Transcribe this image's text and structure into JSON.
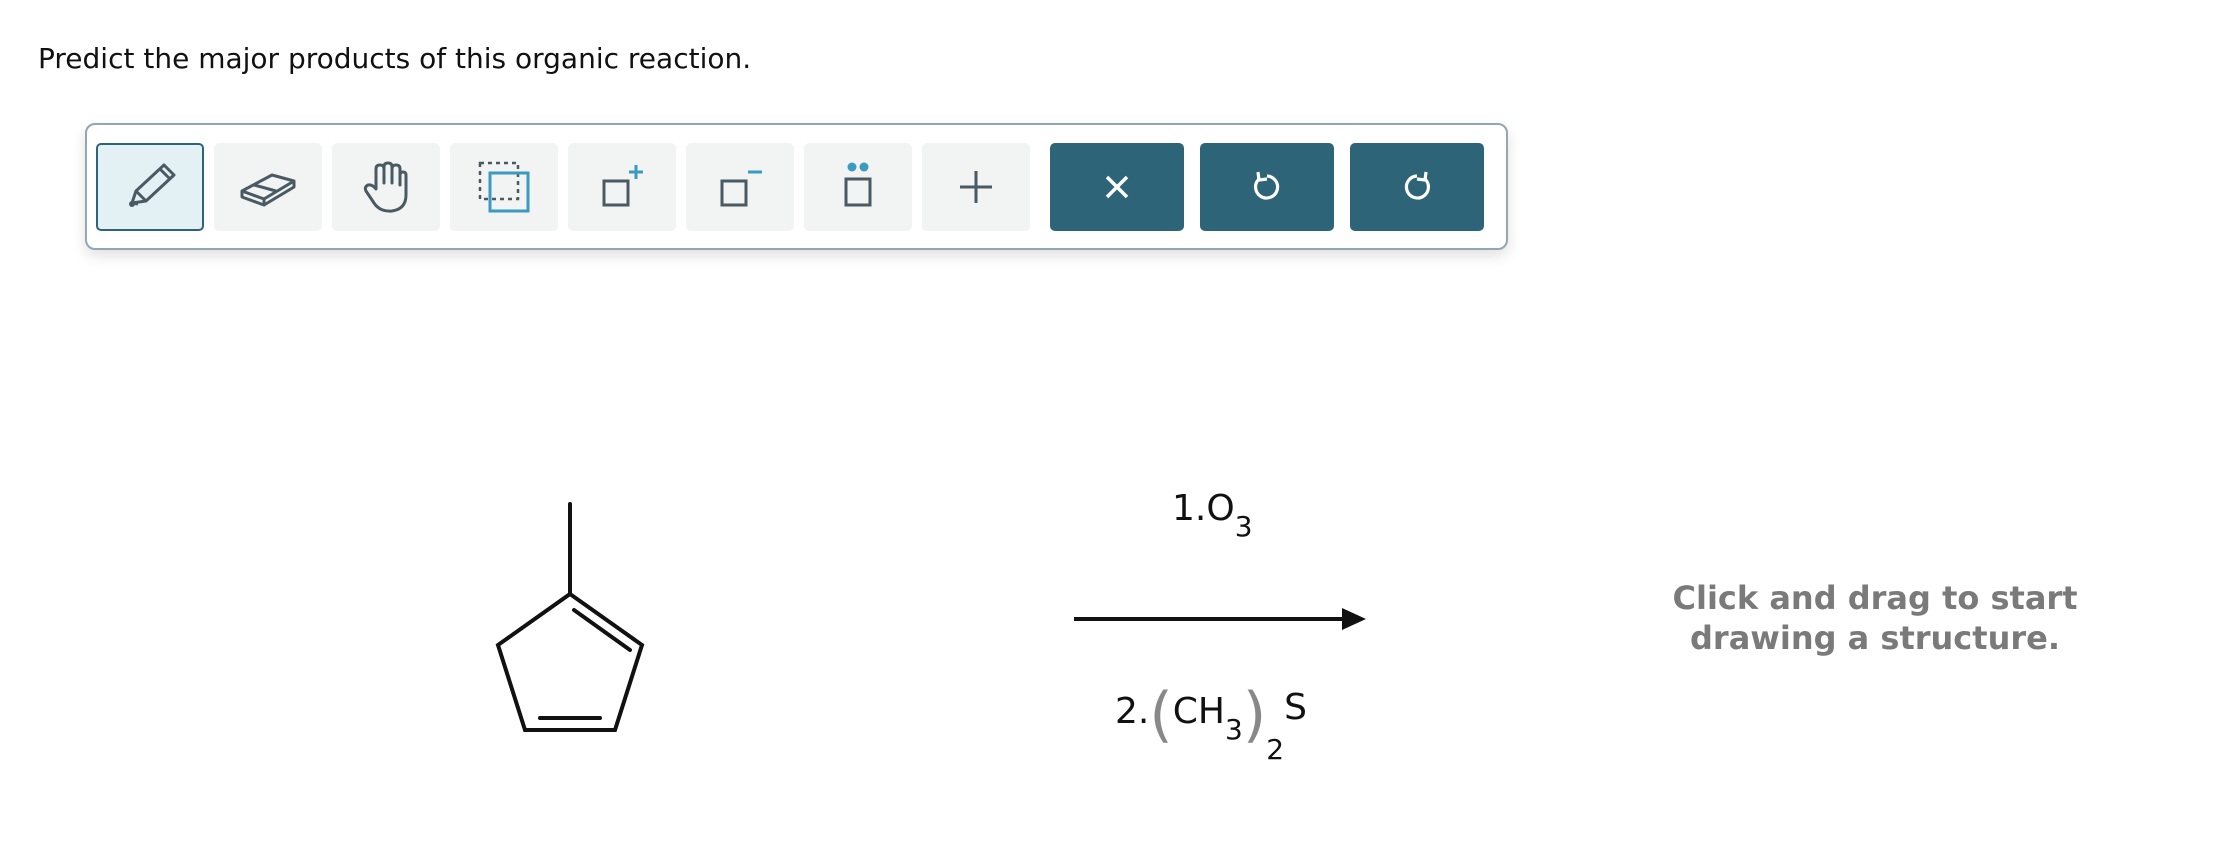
{
  "question": {
    "prompt": "Predict the major products of this organic reaction."
  },
  "toolbar": {
    "tools": [
      {
        "name": "draw",
        "icon": "pencil-icon",
        "selected": true
      },
      {
        "name": "erase",
        "icon": "eraser-icon"
      },
      {
        "name": "move",
        "icon": "hand-icon"
      },
      {
        "name": "select",
        "icon": "lasso-select-icon"
      },
      {
        "name": "increase-charge",
        "icon": "square-plus-icon"
      },
      {
        "name": "decrease-charge",
        "icon": "square-minus-icon"
      },
      {
        "name": "lone-pair",
        "icon": "square-dots-icon"
      },
      {
        "name": "add-arrow",
        "icon": "plus-icon"
      }
    ],
    "actions": [
      {
        "name": "clear",
        "icon": "close-icon"
      },
      {
        "name": "undo",
        "icon": "undo-icon"
      },
      {
        "name": "redo",
        "icon": "redo-icon"
      }
    ],
    "colors": {
      "accent": "#2e6477",
      "tool_bg": "#f2f3f3",
      "selected_bg": "#e3f1f5",
      "icon_blue": "#3a9ac0"
    }
  },
  "reaction": {
    "reactant": "1-methylcyclopenta-1,3-diene skeletal structure",
    "reagent_1": {
      "prefix": "1.",
      "formula": "O",
      "subscript": "3"
    },
    "reagent_2": {
      "prefix": "2.",
      "open": "(",
      "formula": "CH",
      "subscript_1": "3",
      "close": ")",
      "subscript_2": "2",
      "suffix": "S"
    }
  },
  "canvas": {
    "hint_line_1": "Click and drag to start",
    "hint_line_2": "drawing a structure."
  }
}
